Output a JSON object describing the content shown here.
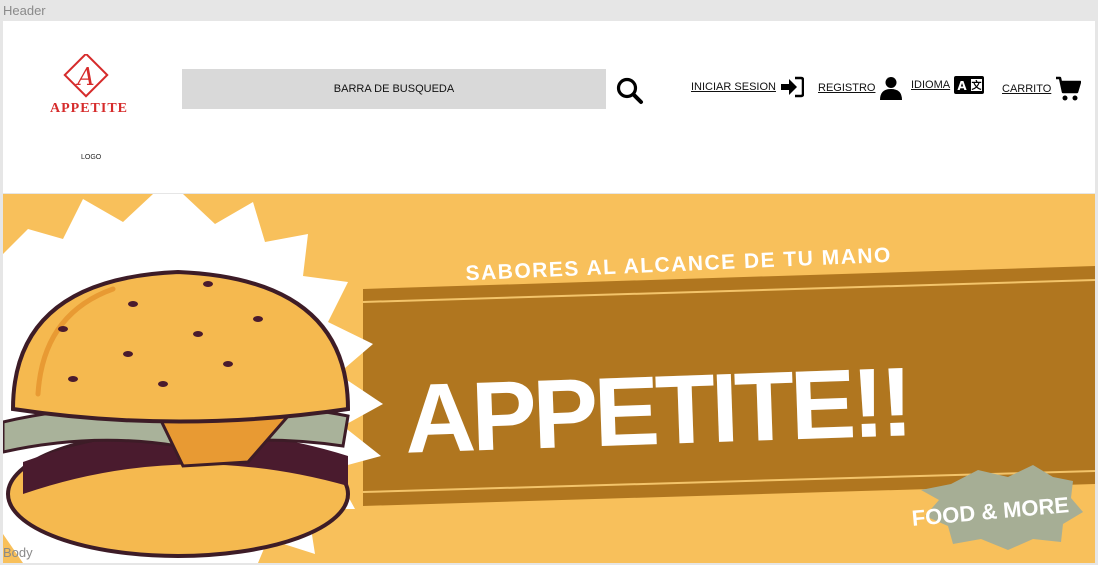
{
  "frame_labels": {
    "header": "Header",
    "body": "Body"
  },
  "logo": {
    "brand": "APPETITE",
    "initial": "A",
    "caption": "LOGO"
  },
  "search": {
    "placeholder_label": "BARRA DE BUSQUEDA",
    "icon": "search-icon"
  },
  "nav": {
    "login": {
      "label": "INICIAR SESION",
      "icon": "sign-in-icon"
    },
    "register": {
      "label": "REGISTRO",
      "icon": "user-icon"
    },
    "language": {
      "label": "IDIOMA",
      "icon": "language-icon"
    },
    "cart": {
      "label": "CARRITO",
      "icon": "shopping-cart-icon"
    }
  },
  "banner": {
    "tagline": "SABORES AL ALCANCE DE TU MANO",
    "headline": "APPETITE!!",
    "badge": "FOOD & MORE"
  },
  "colors": {
    "banner_bg": "#f8c05b",
    "ribbon": "#b0761f",
    "brand_red": "#d62b2b",
    "badge": "#a6ae95"
  }
}
